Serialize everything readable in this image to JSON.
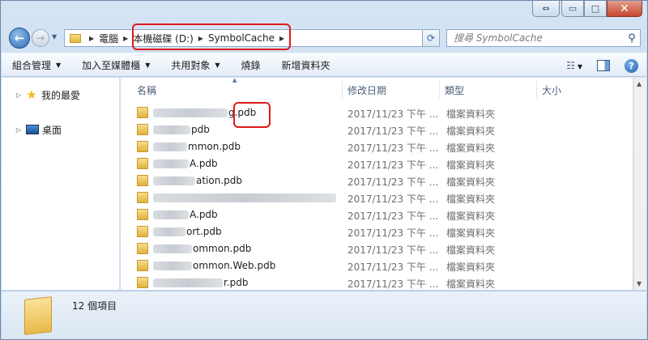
{
  "window": {
    "caption_buttons": {
      "restore": "⇔",
      "minimize": "▭",
      "maximize": "□",
      "close": "✕"
    }
  },
  "address": {
    "breadcrumbs": [
      "電腦",
      "本機磁碟 (D:)",
      "SymbolCache"
    ],
    "search_placeholder": "搜尋 SymbolCache"
  },
  "toolbar": {
    "items": [
      {
        "label": "組合管理",
        "dropdown": true
      },
      {
        "label": "加入至媒體櫃",
        "dropdown": true
      },
      {
        "label": "共用對象",
        "dropdown": true
      },
      {
        "label": "燒錄",
        "dropdown": false
      },
      {
        "label": "新增資料夾",
        "dropdown": false
      }
    ],
    "right_icons": [
      "views-icon",
      "preview-pane-icon",
      "help-icon"
    ]
  },
  "navpane": {
    "items": [
      {
        "label": "我的最愛",
        "icon": "star-icon"
      },
      {
        "label": "桌面",
        "icon": "desktop-icon"
      }
    ]
  },
  "columns": [
    "名稱",
    "修改日期",
    "類型",
    "大小"
  ],
  "files": [
    {
      "name_visible": "g.pdb",
      "date": "2017/11/23 下午 ...",
      "type": "檔案資料夾"
    },
    {
      "name_visible": "pdb",
      "date": "2017/11/23 下午 ...",
      "type": "檔案資料夾"
    },
    {
      "name_visible": "mmon.pdb",
      "date": "2017/11/23 下午 ...",
      "type": "檔案資料夾"
    },
    {
      "name_visible": "A.pdb",
      "date": "2017/11/23 下午 ...",
      "type": "檔案資料夾"
    },
    {
      "name_visible": "ation.pdb",
      "date": "2017/11/23 下午 ...",
      "type": "檔案資料夾"
    },
    {
      "name_visible": "",
      "date": "2017/11/23 下午 ...",
      "type": "檔案資料夾"
    },
    {
      "name_visible": "A.pdb",
      "date": "2017/11/23 下午 ...",
      "type": "檔案資料夾"
    },
    {
      "name_visible": "ort.pdb",
      "date": "2017/11/23 下午 ...",
      "type": "檔案資料夾"
    },
    {
      "name_visible": "ommon.pdb",
      "date": "2017/11/23 下午 ...",
      "type": "檔案資料夾"
    },
    {
      "name_visible": "ommon.Web.pdb",
      "date": "2017/11/23 下午 ...",
      "type": "檔案資料夾"
    },
    {
      "name_visible": "r.pdb",
      "date": "2017/11/23 下午 ...",
      "type": "檔案資料夾"
    }
  ],
  "status": {
    "count_text": "12 個項目"
  },
  "colors": {
    "highlight": "#e01a1a"
  }
}
